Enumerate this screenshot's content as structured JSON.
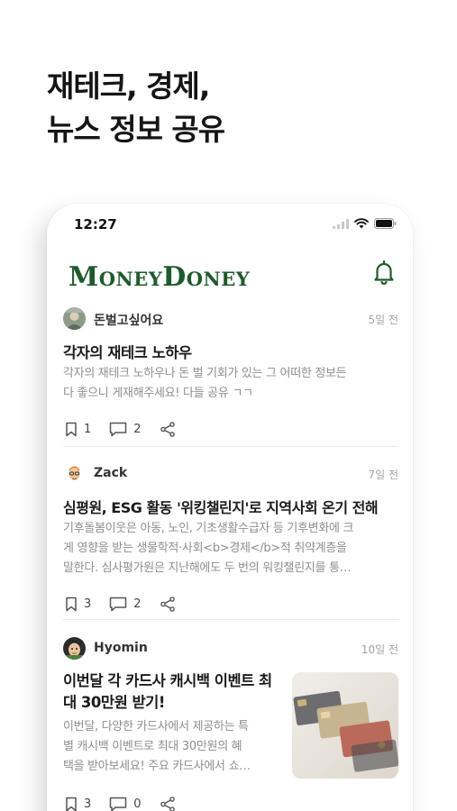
{
  "promo": {
    "line1": "재테크, 경제,",
    "line2": "뉴스 정보 공유"
  },
  "status_bar": {
    "time": "12:27"
  },
  "app": {
    "logo": "MoneyDoney",
    "accent": "#1f5a2c"
  },
  "posts": [
    {
      "author": "돈벌고싶어요",
      "time_ago": "5일 전",
      "title": "각자의 재테크 노하우",
      "body_line1": "각자의 재테크 노하우나 돈 벌 기회가 있는 그 어떠한 정보든",
      "body_line2": "다 좋으니 게재해주세요! 다들 공유 ㄱㄱ",
      "bookmarks": "1",
      "comments": "2"
    },
    {
      "author": "Zack",
      "time_ago": "7일 전",
      "title": "심평원, ESG 활동 '위킹챌린지'로 지역사회 온기 전해",
      "body_line1": "기후돌봄이웃은 아동, 노인, 기초생활수급자 등 기후변화에 크",
      "body_line2": "게 영향을 받는 생물학적·사회<b>경제</b>적 취약계층을",
      "body_line3": "말한다. 심사평가원은 지난해에도 두 번의 워킹챌린지를 통…",
      "bookmarks": "3",
      "comments": "2"
    },
    {
      "author": "Hyomin",
      "time_ago": "10일 전",
      "title_line1": "이번달 각 카드사 캐시백 이벤트 최",
      "title_line2": "대 30만원 받기!",
      "body_line1": "이번달, 다양한 카드사에서 제공하는 특",
      "body_line2": "별 캐시백 이벤트로 최대 30만원의 혜",
      "body_line3": "택을 받아보세요! 주요 카드사에서 쇼…",
      "bookmarks": "3",
      "comments": "0"
    }
  ]
}
